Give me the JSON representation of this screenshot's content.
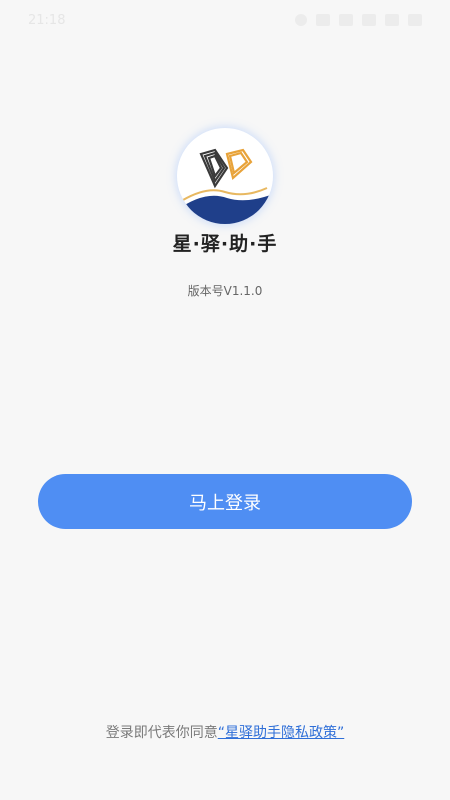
{
  "status_bar": {
    "time": "21:18",
    "icons": [
      "alarm-icon",
      "vibrate-icon",
      "nfc-icon",
      "signal-icon",
      "wifi-icon",
      "battery-icon"
    ]
  },
  "app": {
    "name": "星·驿·助·手",
    "version": "版本号V1.1.0"
  },
  "login_button": {
    "label": "马上登录"
  },
  "agreement": {
    "prefix": "登录即代表你同意",
    "policy_link": "“星驿助手隐私政策”"
  },
  "colors": {
    "primary": "#4f8ef3",
    "logo_gold": "#e8a33a",
    "logo_navy": "#1f3f8a"
  }
}
